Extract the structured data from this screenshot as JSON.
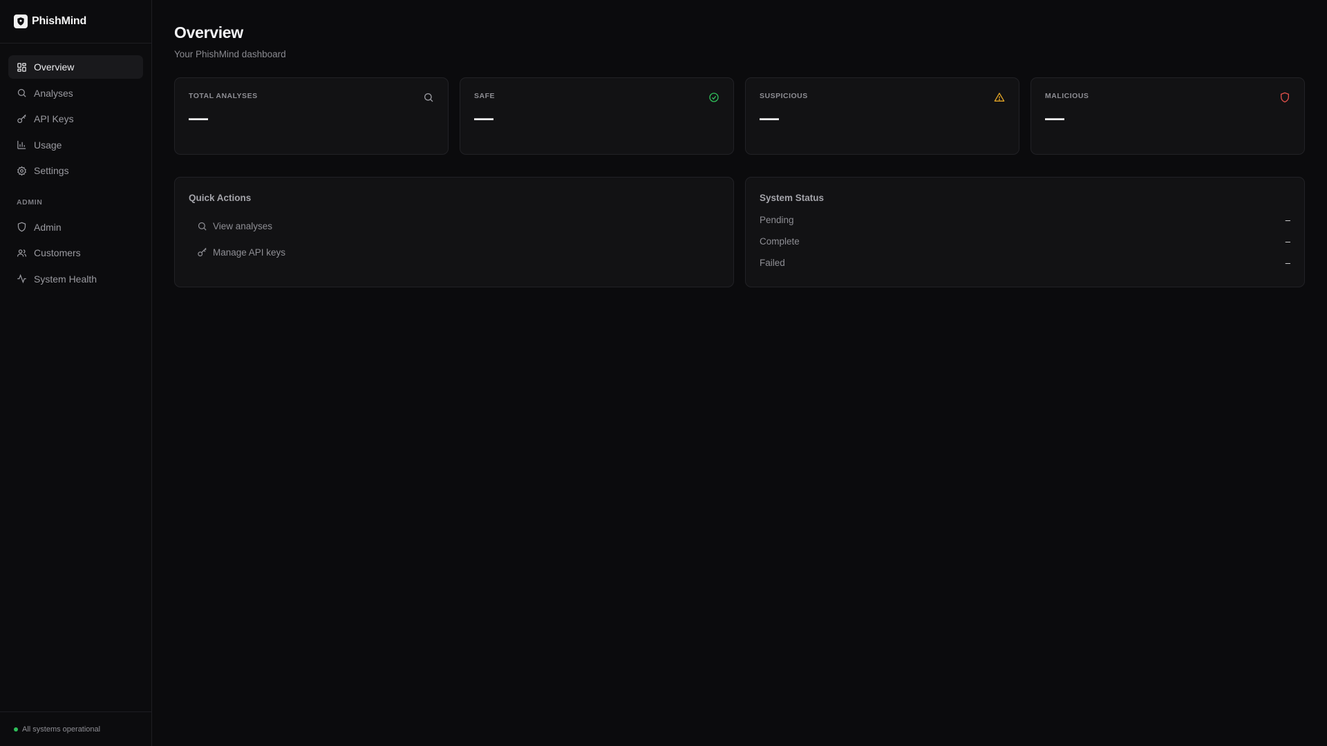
{
  "brand": {
    "name": "PhishMind"
  },
  "nav": {
    "items": [
      {
        "label": "Overview",
        "icon": "grid-icon",
        "active": true
      },
      {
        "label": "Analyses",
        "icon": "search-icon"
      },
      {
        "label": "API Keys",
        "icon": "key-icon"
      },
      {
        "label": "Usage",
        "icon": "bar-chart-icon"
      },
      {
        "label": "Settings",
        "icon": "gear-icon"
      }
    ],
    "admin_section_label": "ADMIN",
    "admin_items": [
      {
        "label": "Admin",
        "icon": "shield-icon"
      },
      {
        "label": "Customers",
        "icon": "users-icon"
      },
      {
        "label": "System Health",
        "icon": "activity-icon"
      }
    ]
  },
  "footer": {
    "status_text": "All systems operational",
    "status_color": "#2fbf5a"
  },
  "page": {
    "title": "Overview",
    "subtitle": "Your PhishMind dashboard"
  },
  "stats": [
    {
      "label": "TOTAL ANALYSES",
      "value": "—",
      "icon": "search-icon",
      "color": "#9a9aa0"
    },
    {
      "label": "SAFE",
      "value": "—",
      "icon": "check-circle-icon",
      "color": "#2fbf5a"
    },
    {
      "label": "SUSPICIOUS",
      "value": "—",
      "icon": "warning-triangle-icon",
      "color": "#e0a326"
    },
    {
      "label": "MALICIOUS",
      "value": "—",
      "icon": "shield-icon",
      "color": "#e0504a"
    }
  ],
  "quick_actions": {
    "title": "Quick Actions",
    "items": [
      {
        "label": "View analyses",
        "icon": "search-icon"
      },
      {
        "label": "Manage API keys",
        "icon": "key-icon"
      }
    ]
  },
  "system_status": {
    "title": "System Status",
    "rows": [
      {
        "label": "Pending",
        "value": "–"
      },
      {
        "label": "Complete",
        "value": "–"
      },
      {
        "label": "Failed",
        "value": "–"
      }
    ]
  }
}
